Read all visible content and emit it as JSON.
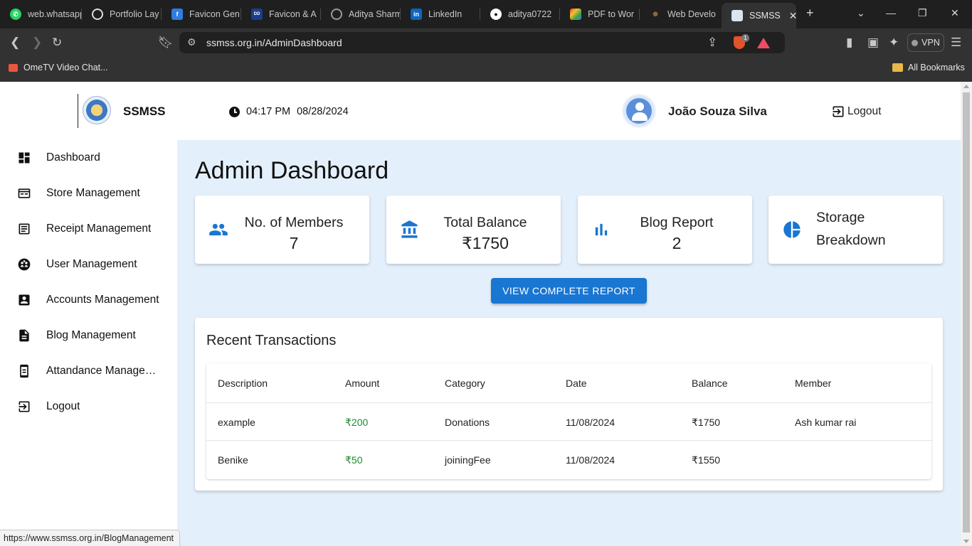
{
  "browser": {
    "tabs": [
      {
        "title": "web.whatsapp",
        "favicon": "whatsapp-icon",
        "color": "#25d366"
      },
      {
        "title": "Portfolio Lay",
        "favicon": "chatgpt-icon",
        "color": "#ffffff"
      },
      {
        "title": "Favicon Gen",
        "favicon": "favicon-generator-icon",
        "color": "#2f7de1"
      },
      {
        "title": "Favicon & A",
        "favicon": "favicon-dole-icon",
        "color": "#1a3d8f"
      },
      {
        "title": "Aditya Sharm",
        "favicon": "globe-icon",
        "color": "#9a9a9a"
      },
      {
        "title": "LinkedIn",
        "favicon": "linkedin-icon",
        "color": "#0a66c2"
      },
      {
        "title": "aditya0722",
        "favicon": "github-icon",
        "color": "#ffffff"
      },
      {
        "title": "PDF to Wor",
        "favicon": "pdf-icon",
        "color": "#e53935"
      },
      {
        "title": "Web Develo",
        "favicon": "web-dev-icon",
        "color": "#8a6d3b"
      },
      {
        "title": "SSMSS",
        "favicon": "ssmss-icon",
        "color": "#3b78c5",
        "active": true
      }
    ],
    "url": "ssmss.org.in/AdminDashboard",
    "shield_badge": "1",
    "vpn_label": "VPN",
    "bookmarks": [
      {
        "label": "OmeTV Video Chat..."
      },
      {
        "label": "All Bookmarks"
      }
    ],
    "status_url": "https://www.ssmss.org.in/BlogManagement"
  },
  "header": {
    "brand": "SSMSS",
    "time": "04:17 PM",
    "date": "08/28/2024",
    "user_name": "João Souza Silva",
    "logout_label": "Logout"
  },
  "sidebar": {
    "items": [
      {
        "label": "Dashboard",
        "icon": "dashboard-icon"
      },
      {
        "label": "Store Management",
        "icon": "store-icon"
      },
      {
        "label": "Receipt Management",
        "icon": "receipt-icon"
      },
      {
        "label": "User Management",
        "icon": "user-group-icon"
      },
      {
        "label": "Accounts Management",
        "icon": "account-box-icon"
      },
      {
        "label": "Blog Management",
        "icon": "document-icon"
      },
      {
        "label": "Attandance Management",
        "icon": "attendance-icon"
      },
      {
        "label": "Logout",
        "icon": "logout-icon"
      }
    ]
  },
  "main": {
    "title": "Admin Dashboard",
    "cards": [
      {
        "label": "No. of Members",
        "value": "7",
        "icon": "people-icon"
      },
      {
        "label": "Total Balance",
        "value": "₹1750",
        "icon": "bank-icon"
      },
      {
        "label": "Blog Report",
        "value": "2",
        "icon": "bar-chart-icon"
      },
      {
        "label": "Storage Breakdown",
        "value": "",
        "icon": "pie-chart-icon"
      }
    ],
    "report_button": "VIEW COMPLETE REPORT",
    "transactions": {
      "title": "Recent Transactions",
      "columns": [
        "Description",
        "Amount",
        "Category",
        "Date",
        "Balance",
        "Member"
      ],
      "rows": [
        [
          "example",
          "₹200",
          "Donations",
          "11/08/2024",
          "₹1750",
          "Ash kumar rai"
        ],
        [
          "Benike",
          "₹50",
          "joiningFee",
          "11/08/2024",
          "₹1550",
          ""
        ]
      ]
    },
    "accent_color": "#1976d2",
    "amount_color": "#1e8a2e",
    "background_color": "#e3f0fb"
  }
}
